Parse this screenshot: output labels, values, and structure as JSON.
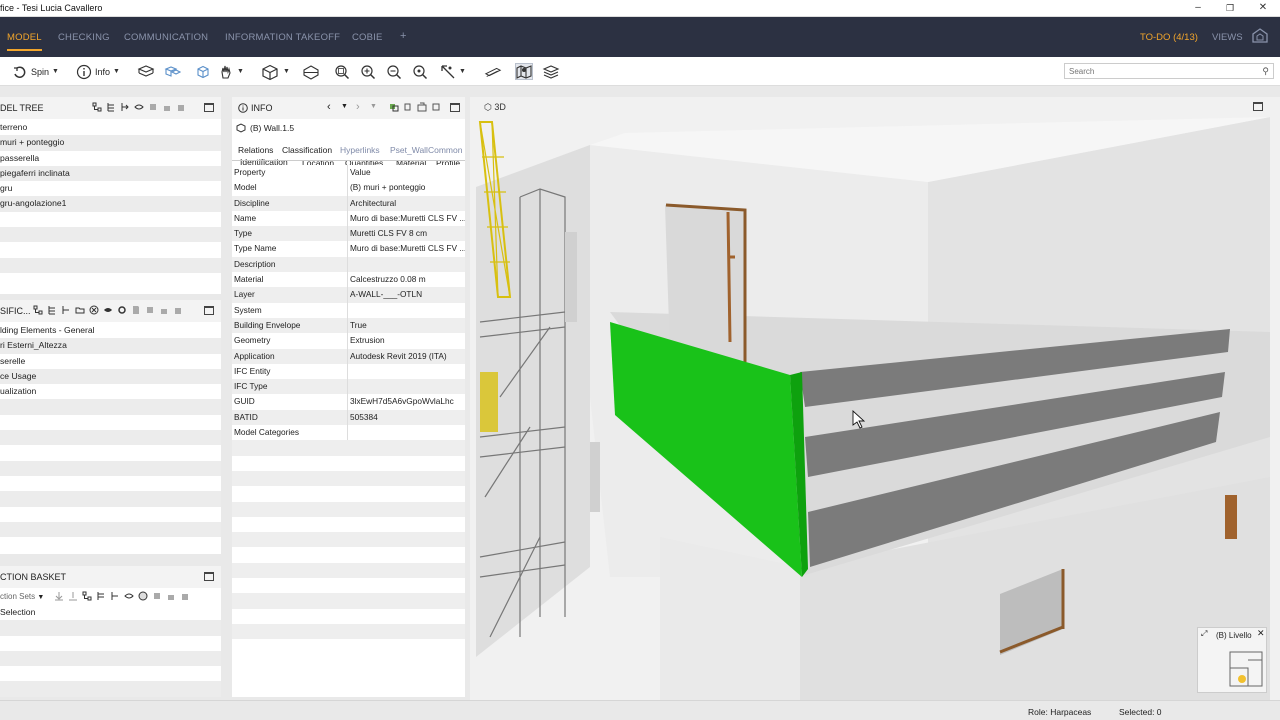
{
  "window": {
    "title": "fice - Tesi Lucia Cavallero"
  },
  "nav": {
    "tabs": [
      "MODEL",
      "CHECKING",
      "COMMUNICATION",
      "INFORMATION TAKEOFF",
      "COBIE"
    ],
    "add": "+",
    "todo": "TO-DO (4/13)",
    "views": "VIEWS"
  },
  "toolbar": {
    "spin": "Spin",
    "info": "Info",
    "search_placeholder": "Search"
  },
  "model_tree": {
    "title": "DEL TREE",
    "items": [
      "terreno",
      "muri + ponteggio",
      "passerella",
      "piegaferri inclinata",
      "gru",
      "gru-angolazione1"
    ]
  },
  "classification": {
    "title": "SIFIC...",
    "items": [
      "lding Elements - General",
      "ri Esterni_Altezza",
      "serelle",
      "ce Usage",
      "ualization"
    ]
  },
  "selection_basket": {
    "title": "CTION BASKET",
    "sets_label": "ction Sets",
    "items": [
      "Selection"
    ]
  },
  "info_panel": {
    "title": "INFO",
    "object": "(B) Wall.1.5",
    "tabs_row1": [
      "Relations",
      "Classification",
      "Hyperlinks",
      "Pset_WallCommon"
    ],
    "tabs_row2": [
      "Identification",
      "Location",
      "Quantities",
      "Material",
      "Profile"
    ],
    "columns": [
      "Property",
      "Value"
    ],
    "properties": [
      [
        "Model",
        "(B) muri + ponteggio"
      ],
      [
        "Discipline",
        "Architectural"
      ],
      [
        "Name",
        "Muro di base:Muretti CLS FV ..."
      ],
      [
        "Type",
        "Muretti CLS FV 8 cm"
      ],
      [
        "Type Name",
        "Muro di base:Muretti CLS FV ..."
      ],
      [
        "Description",
        ""
      ],
      [
        "Material",
        "Calcestruzzo 0.08 m"
      ],
      [
        "Layer",
        "A-WALL-___-OTLN"
      ],
      [
        "System",
        ""
      ],
      [
        "Building Envelope",
        "True"
      ],
      [
        "Geometry",
        "Extrusion"
      ],
      [
        "Application",
        "Autodesk Revit 2019 (ITA)"
      ],
      [
        "IFC Entity",
        ""
      ],
      [
        "IFC Type",
        ""
      ],
      [
        "GUID",
        "3lxEwH7d5A6vGpoWvlaLhc"
      ],
      [
        "BATID",
        "505384"
      ],
      [
        "Model Categories",
        ""
      ]
    ]
  },
  "view3d": {
    "label": "3D",
    "minimap_label": "(B) Livello"
  },
  "status": {
    "role": "Role: Harpaceas",
    "selected": "Selected: 0"
  },
  "colors": {
    "nav_bg": "#2c3142",
    "accent": "#f2a52b",
    "highlight": "#19c219"
  }
}
